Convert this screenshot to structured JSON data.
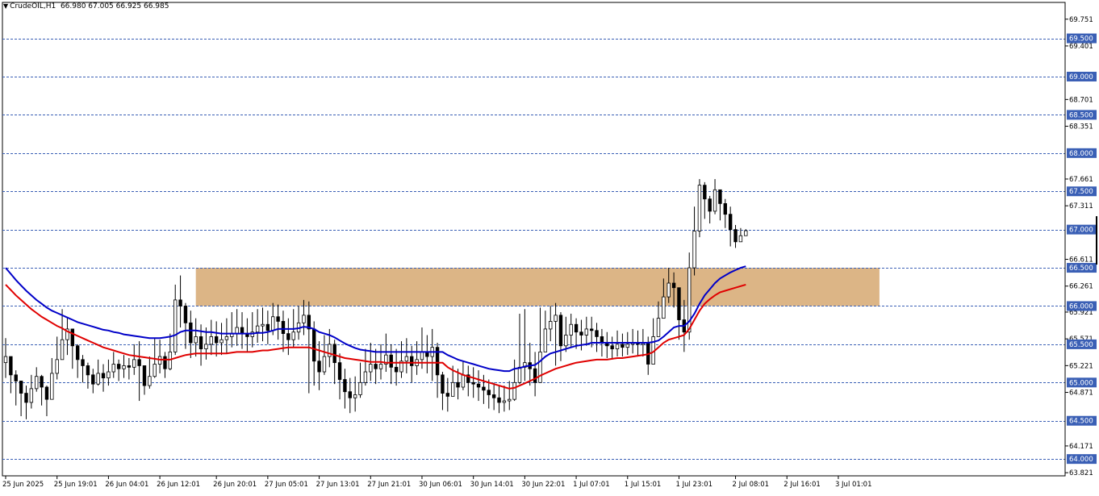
{
  "header": {
    "symbol": "CrudeOIL,H1",
    "ohlc": "66.980 67.005 66.925 66.985"
  },
  "colors": {
    "candle_up_fill": "#ffffff",
    "candle_down_fill": "#000000",
    "ma_fast": "#0000c8",
    "ma_slow": "#e00000",
    "level_line": "#3a5fb5",
    "level_tag_bg": "#3a5fb5",
    "zone_fill": "#dcb586"
  },
  "chart_data": {
    "type": "candlestick",
    "ylim": [
      63.78,
      69.97
    ],
    "price_ticks": [
      "69.751",
      "69.401",
      "68.701",
      "68.351",
      "67.661",
      "67.311",
      "66.611",
      "66.261",
      "65.921",
      "65.571",
      "65.221",
      "64.871",
      "64.171",
      "63.821"
    ],
    "levels": [
      "69.500",
      "69.000",
      "68.500",
      "68.000",
      "67.500",
      "67.000",
      "66.500",
      "66.000",
      "65.500",
      "65.000",
      "64.500",
      "64.000"
    ],
    "zone": {
      "low": 66.0,
      "high": 66.5,
      "from_bar": 37,
      "to_bar": 170
    },
    "time_labels": [
      {
        "bar": 0,
        "text": "25 Jun 2025"
      },
      {
        "bar": 10,
        "text": "25 Jun 19:01"
      },
      {
        "bar": 20,
        "text": "26 Jun 04:01"
      },
      {
        "bar": 30,
        "text": "26 Jun 12:01"
      },
      {
        "bar": 41,
        "text": "26 Jun 20:01"
      },
      {
        "bar": 51,
        "text": "27 Jun 05:01"
      },
      {
        "bar": 61,
        "text": "27 Jun 13:01"
      },
      {
        "bar": 71,
        "text": "27 Jun 21:01"
      },
      {
        "bar": 81,
        "text": "30 Jun 06:01"
      },
      {
        "bar": 91,
        "text": "30 Jun 14:01"
      },
      {
        "bar": 101,
        "text": "30 Jun 22:01"
      },
      {
        "bar": 111,
        "text": "1 Jul 07:01"
      },
      {
        "bar": 121,
        "text": "1 Jul 15:01"
      },
      {
        "bar": 131,
        "text": "1 Jul 23:01"
      },
      {
        "bar": 142,
        "text": "2 Jul 08:01"
      },
      {
        "bar": 152,
        "text": "2 Jul 16:01"
      },
      {
        "bar": 162,
        "text": "3 Jul 01:01"
      }
    ],
    "close": [
      65.34,
      65.1,
      65.02,
      64.86,
      64.74,
      64.92,
      65.08,
      64.94,
      64.78,
      65.12,
      65.3,
      65.56,
      65.7,
      65.48,
      65.3,
      65.22,
      65.1,
      64.98,
      65.12,
      65.06,
      65.14,
      65.24,
      65.18,
      65.22,
      65.2,
      65.3,
      65.22,
      64.96,
      65.08,
      65.24,
      65.34,
      65.18,
      65.4,
      66.08,
      66.0,
      65.78,
      65.52,
      65.6,
      65.44,
      65.5,
      65.6,
      65.52,
      65.56,
      65.6,
      65.64,
      65.72,
      65.64,
      65.6,
      65.66,
      65.74,
      65.76,
      65.68,
      65.86,
      65.8,
      65.64,
      65.56,
      65.66,
      65.78,
      65.88,
      65.7,
      65.28,
      65.14,
      65.34,
      65.5,
      65.26,
      65.04,
      64.88,
      64.8,
      64.84,
      65.0,
      65.14,
      65.24,
      65.18,
      65.24,
      65.36,
      65.2,
      65.14,
      65.28,
      65.34,
      65.22,
      65.3,
      65.4,
      65.34,
      65.46,
      65.1,
      64.86,
      64.82,
      65.0,
      64.94,
      65.1,
      65.0,
      64.98,
      64.94,
      64.9,
      64.84,
      64.8,
      64.74,
      64.76,
      64.78,
      65.0,
      65.2,
      65.26,
      65.18,
      65.0,
      65.4,
      65.7,
      65.8,
      65.88,
      65.48,
      65.62,
      65.76,
      65.66,
      65.62,
      65.7,
      65.68,
      65.6,
      65.52,
      65.48,
      65.44,
      65.5,
      65.46,
      65.5,
      65.52,
      65.5,
      65.52,
      65.24,
      65.6,
      65.84,
      66.12,
      66.3,
      66.24,
      65.82,
      65.66,
      66.5,
      66.98,
      67.58,
      67.4,
      67.24,
      67.52,
      67.34,
      67.2,
      67.0,
      66.84,
      66.92,
      66.985
    ],
    "high": [
      65.58,
      65.28,
      65.16,
      65.0,
      64.96,
      65.1,
      65.2,
      65.1,
      64.96,
      65.32,
      65.6,
      65.96,
      65.84,
      65.7,
      65.5,
      65.36,
      65.26,
      65.18,
      65.3,
      65.24,
      65.3,
      65.4,
      65.3,
      65.36,
      65.32,
      65.5,
      65.54,
      65.2,
      65.34,
      65.58,
      65.56,
      65.4,
      65.64,
      66.28,
      66.4,
      66.04,
      65.94,
      65.84,
      65.76,
      65.72,
      65.82,
      65.8,
      65.78,
      65.84,
      65.92,
      65.96,
      65.92,
      65.84,
      65.92,
      65.96,
      65.98,
      65.94,
      66.04,
      66.02,
      65.94,
      65.84,
      65.96,
      66.0,
      66.08,
      66.06,
      65.8,
      65.54,
      65.62,
      65.7,
      65.56,
      65.38,
      65.18,
      65.06,
      65.08,
      65.26,
      65.44,
      65.52,
      65.44,
      65.5,
      65.64,
      65.5,
      65.44,
      65.54,
      65.58,
      65.48,
      65.54,
      65.72,
      65.62,
      65.7,
      65.52,
      65.14,
      65.06,
      65.22,
      65.18,
      65.28,
      65.22,
      65.2,
      65.16,
      65.1,
      65.04,
      65.0,
      64.96,
      64.96,
      65.02,
      65.3,
      65.9,
      65.96,
      65.52,
      65.4,
      65.98,
      65.94,
      66.0,
      66.04,
      65.92,
      65.86,
      65.9,
      65.84,
      65.82,
      65.86,
      65.86,
      65.78,
      65.7,
      65.66,
      65.6,
      65.68,
      65.64,
      65.66,
      65.7,
      65.68,
      65.7,
      65.6,
      65.84,
      66.06,
      66.36,
      66.5,
      66.44,
      66.18,
      66.08,
      66.7,
      67.3,
      67.66,
      67.62,
      67.44,
      67.66,
      67.48,
      67.4,
      67.3,
      67.06,
      67.02,
      67.005
    ],
    "low": [
      65.06,
      64.86,
      64.7,
      64.56,
      64.52,
      64.66,
      64.88,
      64.7,
      64.56,
      64.94,
      65.04,
      65.34,
      65.36,
      65.18,
      65.06,
      65.0,
      64.92,
      64.86,
      64.96,
      64.88,
      64.96,
      65.06,
      65.02,
      65.06,
      65.04,
      65.1,
      64.76,
      64.84,
      64.92,
      65.06,
      65.12,
      65.06,
      65.16,
      65.36,
      65.72,
      65.44,
      65.32,
      65.34,
      65.22,
      65.3,
      65.36,
      65.34,
      65.36,
      65.38,
      65.46,
      65.48,
      65.44,
      65.4,
      65.46,
      65.52,
      65.54,
      65.5,
      65.62,
      65.56,
      65.4,
      65.36,
      65.46,
      65.56,
      65.62,
      64.86,
      64.96,
      64.9,
      65.1,
      65.2,
      64.98,
      64.78,
      64.66,
      64.6,
      64.62,
      64.8,
      64.96,
      65.02,
      64.98,
      65.04,
      65.14,
      64.98,
      64.96,
      65.06,
      65.12,
      65.0,
      65.1,
      65.18,
      65.12,
      65.02,
      64.8,
      64.64,
      64.62,
      64.82,
      64.78,
      64.9,
      64.82,
      64.8,
      64.76,
      64.72,
      64.66,
      64.64,
      64.6,
      64.62,
      64.64,
      64.76,
      64.98,
      65.02,
      64.96,
      64.82,
      65.18,
      65.44,
      65.54,
      65.22,
      65.28,
      65.4,
      65.46,
      65.44,
      65.42,
      65.48,
      65.46,
      65.4,
      65.34,
      65.32,
      65.3,
      65.34,
      65.34,
      65.36,
      65.38,
      65.34,
      65.34,
      65.1,
      65.24,
      65.6,
      65.86,
      66.04,
      65.98,
      65.56,
      65.4,
      65.56,
      66.4,
      66.9,
      67.14,
      67.08,
      67.2,
      67.12,
      67.02,
      66.78,
      66.76,
      66.84,
      66.925
    ],
    "ma_fast": [
      66.5,
      66.42,
      66.34,
      66.27,
      66.2,
      66.14,
      66.08,
      66.03,
      65.98,
      65.94,
      65.91,
      65.88,
      65.85,
      65.82,
      65.79,
      65.77,
      65.75,
      65.73,
      65.71,
      65.69,
      65.68,
      65.66,
      65.65,
      65.63,
      65.62,
      65.61,
      65.6,
      65.59,
      65.58,
      65.58,
      65.58,
      65.59,
      65.6,
      65.62,
      65.66,
      65.68,
      65.68,
      65.68,
      65.67,
      65.66,
      65.66,
      65.65,
      65.64,
      65.64,
      65.64,
      65.64,
      65.64,
      65.64,
      65.64,
      65.65,
      65.65,
      65.66,
      65.68,
      65.7,
      65.7,
      65.7,
      65.7,
      65.71,
      65.73,
      65.72,
      65.7,
      65.66,
      65.64,
      65.62,
      65.59,
      65.55,
      65.51,
      65.48,
      65.45,
      65.43,
      65.42,
      65.41,
      65.4,
      65.4,
      65.4,
      65.4,
      65.4,
      65.4,
      65.4,
      65.4,
      65.4,
      65.4,
      65.4,
      65.4,
      65.4,
      65.4,
      65.36,
      65.33,
      65.3,
      65.28,
      65.26,
      65.24,
      65.22,
      65.2,
      65.18,
      65.17,
      65.16,
      65.15,
      65.15,
      65.18,
      65.19,
      65.21,
      65.22,
      65.23,
      65.28,
      65.34,
      65.38,
      65.4,
      65.42,
      65.44,
      65.46,
      65.48,
      65.49,
      65.5,
      65.52,
      65.52,
      65.52,
      65.52,
      65.52,
      65.52,
      65.52,
      65.52,
      65.52,
      65.52,
      65.52,
      65.52,
      65.53,
      65.55,
      65.6,
      65.66,
      65.72,
      65.74,
      65.74,
      65.8,
      65.9,
      66.03,
      66.14,
      66.22,
      66.3,
      66.36,
      66.4,
      66.44,
      66.47,
      66.5,
      66.52
    ],
    "ma_slow": [
      66.28,
      66.21,
      66.14,
      66.08,
      66.02,
      65.96,
      65.91,
      65.86,
      65.82,
      65.78,
      65.74,
      65.71,
      65.67,
      65.64,
      65.61,
      65.58,
      65.55,
      65.52,
      65.49,
      65.46,
      65.44,
      65.42,
      65.4,
      65.38,
      65.36,
      65.35,
      65.34,
      65.33,
      65.32,
      65.31,
      65.3,
      65.3,
      65.3,
      65.32,
      65.34,
      65.36,
      65.37,
      65.38,
      65.38,
      65.38,
      65.38,
      65.38,
      65.38,
      65.38,
      65.39,
      65.4,
      65.4,
      65.4,
      65.4,
      65.41,
      65.42,
      65.42,
      65.43,
      65.44,
      65.45,
      65.46,
      65.46,
      65.46,
      65.46,
      65.46,
      65.44,
      65.42,
      65.4,
      65.38,
      65.36,
      65.34,
      65.32,
      65.31,
      65.3,
      65.29,
      65.28,
      65.27,
      65.27,
      65.27,
      65.26,
      65.26,
      65.26,
      65.26,
      65.26,
      65.26,
      65.26,
      65.26,
      65.26,
      65.26,
      65.26,
      65.26,
      65.2,
      65.16,
      65.13,
      65.1,
      65.08,
      65.06,
      65.04,
      65.02,
      65.0,
      64.98,
      64.96,
      64.94,
      64.92,
      64.93,
      64.96,
      64.99,
      65.02,
      65.05,
      65.09,
      65.12,
      65.15,
      65.18,
      65.2,
      65.22,
      65.24,
      65.26,
      65.27,
      65.28,
      65.29,
      65.3,
      65.3,
      65.3,
      65.31,
      65.32,
      65.32,
      65.33,
      65.34,
      65.35,
      65.36,
      65.37,
      65.4,
      65.46,
      65.52,
      65.56,
      65.58,
      65.6,
      65.62,
      65.7,
      65.82,
      65.94,
      66.03,
      66.09,
      66.14,
      66.18,
      66.2,
      66.22,
      66.24,
      66.26,
      66.28
    ]
  }
}
